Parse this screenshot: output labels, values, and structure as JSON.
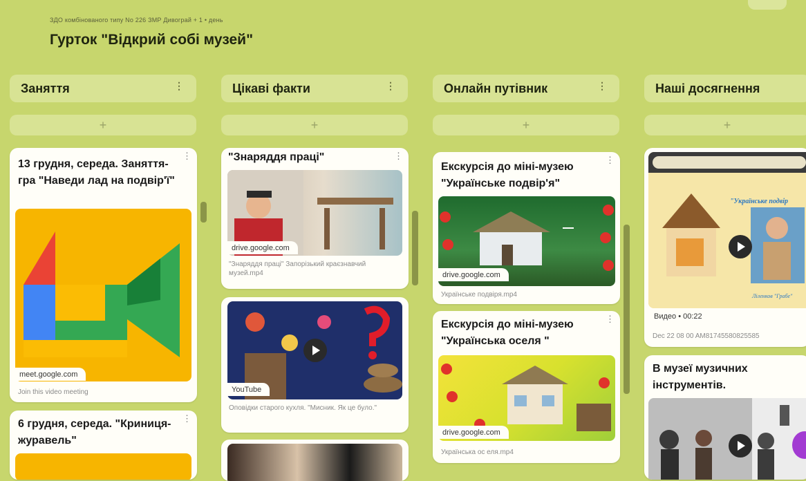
{
  "header": {
    "subtitle": "ЗДО комбінованого типу No 226 ЗМР Дивограй + 1 • день",
    "title": "Гурток \"Відкрий собі музей\""
  },
  "columns": [
    {
      "title": "Заняття",
      "add_label": "+"
    },
    {
      "title": "Цікаві факти",
      "add_label": "+"
    },
    {
      "title": "Онлайн путівник",
      "add_label": "+"
    },
    {
      "title": "Наші досягнення",
      "add_label": "+"
    }
  ],
  "kebab": "⋮",
  "posts": {
    "c1p1": {
      "title": "13 грудня, середа. Заняття- гра \"Наведи лад на подвір'ї\"",
      "source": "meet.google.com",
      "caption": "Join this video meeting"
    },
    "c1p2": {
      "title": "6 грудня, середа. \"Криниця- журавель\""
    },
    "c2p1": {
      "title": "\"Знаряддя праці\"",
      "source": "drive.google.com",
      "caption": "\"Знаряддя праці\" Запорізький краєзнавчий музей.mp4"
    },
    "c2p2": {
      "source": "YouTube",
      "caption": "Оповідки старого кухля. \"Мисник. Як це було.\""
    },
    "c3p1": {
      "title": "Екскурсія до міні-музею \"Українське подвір'я\"",
      "source": "drive.google.com",
      "caption": "Українське подвіря.mp4"
    },
    "c3p2": {
      "title": "Екскурсія до міні-музею \"Українська оселя \"",
      "source": "drive.google.com",
      "caption": "Українська ос еля.mp4"
    },
    "c4p1": {
      "overlay_text": "\"Українське подвір",
      "image_caption": "Ліленков \"Грабе\"",
      "meta": "Видео • 00:22",
      "caption": "Dec 22 08 00 AM81745580825585"
    },
    "c4p2": {
      "title": "В музеї музичних інструментів."
    }
  },
  "colors": {
    "background": "#c7d66d",
    "column_header": "#d8e394",
    "card": "#fffef8",
    "scrollbar": "#8b9548",
    "accent_purple": "#a23bd2"
  }
}
